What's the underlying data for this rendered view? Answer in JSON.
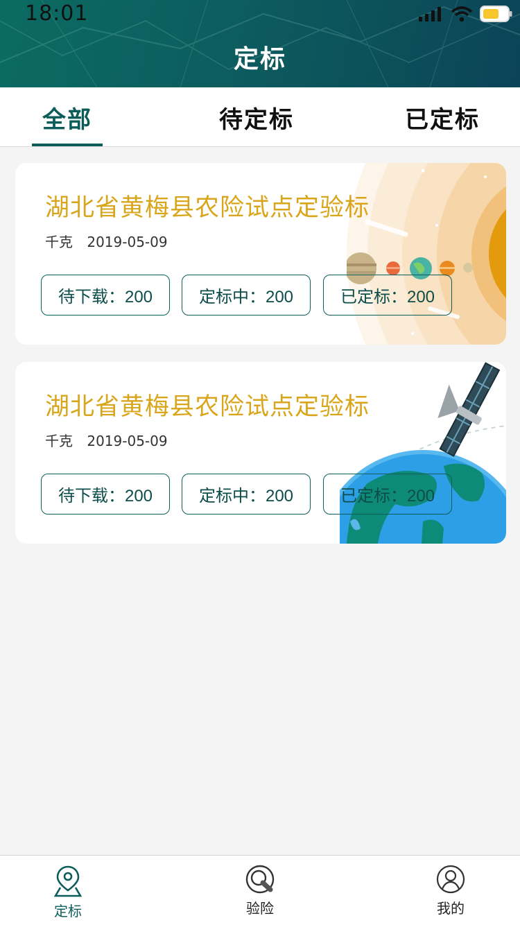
{
  "status_bar": {
    "time": "18:01",
    "icons": [
      "signal-icon",
      "wifi-icon",
      "battery-icon"
    ],
    "battery_color": "#f7c52c"
  },
  "header": {
    "title": "定标",
    "background": "#0c5d5a"
  },
  "tabs": [
    {
      "label": "全部",
      "active": true
    },
    {
      "label": "待定标",
      "active": false
    },
    {
      "label": "已定标",
      "active": false
    }
  ],
  "cards": [
    {
      "title": "湖北省黄梅县农险试点定验标",
      "unit": "千克",
      "date": "2019-05-09",
      "buttons": [
        "待下载：200",
        "定标中：200",
        "已定标：200"
      ],
      "art": "solar-system-illustration"
    },
    {
      "title": "湖北省黄梅县农险试点定验标",
      "unit": "千克",
      "date": "2019-05-09",
      "buttons": [
        "待下载：200",
        "定标中：200",
        "已定标：200"
      ],
      "art": "satellite-earth-illustration"
    }
  ],
  "bottom_nav": [
    {
      "label": "定标",
      "icon": "map-pin-icon",
      "active": true
    },
    {
      "label": "验险",
      "icon": "inspect-icon",
      "active": false
    },
    {
      "label": "我的",
      "icon": "user-icon",
      "active": false
    }
  ],
  "colors": {
    "accent": "#0c5d5a",
    "title_gold": "#d9a51b",
    "background": "#f4f4f4"
  }
}
